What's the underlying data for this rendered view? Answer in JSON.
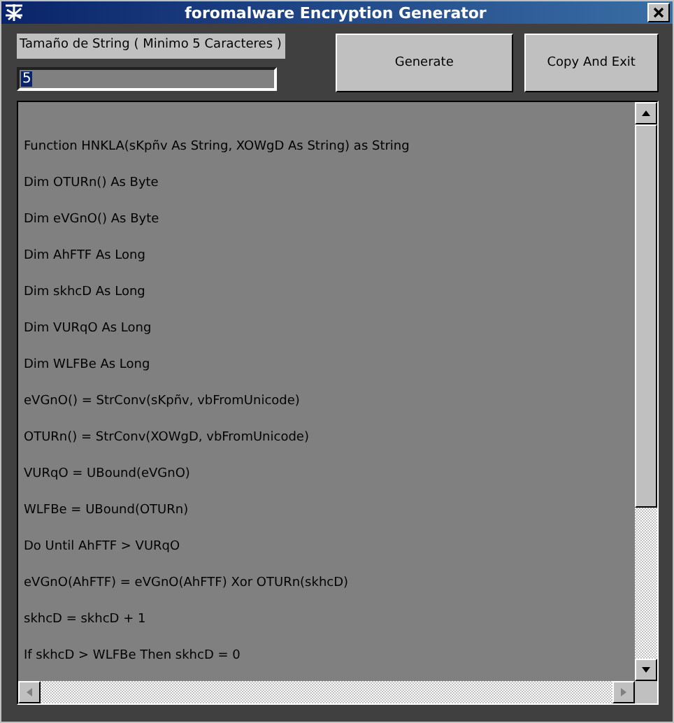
{
  "window": {
    "title": "foromalware Encryption Generator"
  },
  "length_label": "Tamaño de String ( Minimo 5 Caracteres )",
  "length_input": {
    "value": "5",
    "value_selected": true
  },
  "buttons": [
    "Generate",
    "Copy And Exit"
  ],
  "code_lines": [
    "Function HNKLA(sKpñv As String, XOWgD As String) as String",
    "Dim OTURn() As Byte",
    "Dim eVGnO() As Byte",
    "Dim AhFTF As Long",
    "Dim skhcD As Long",
    "Dim VURqO As Long",
    "Dim WLFBe As Long",
    "eVGnO() = StrConv(sKpñv, vbFromUnicode)",
    "OTURn() = StrConv(XOWgD, vbFromUnicode)",
    "VURqO = UBound(eVGnO)",
    "WLFBe = UBound(OTURn)",
    "Do Until AhFTF > VURqO",
    "eVGnO(AhFTF) = eVGnO(AhFTF) Xor OTURn(skhcD)",
    "skhcD = skhcD + 1",
    "If skhcD > WLFBe Then skhcD = 0"
  ]
}
